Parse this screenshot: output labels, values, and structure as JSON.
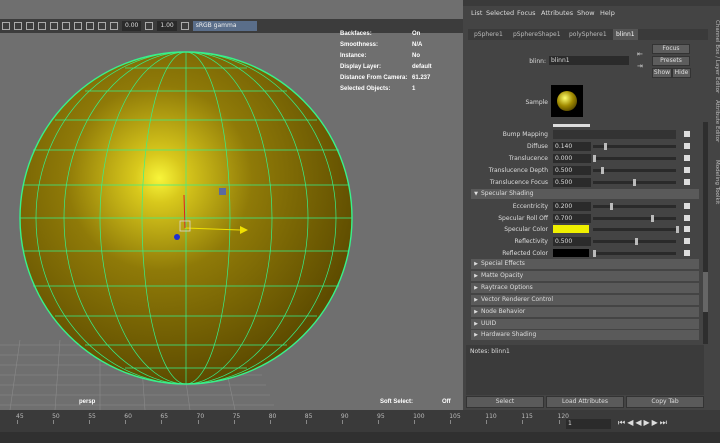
{
  "viewport": {
    "toolbar": {
      "value1": "0.00",
      "value2": "1.00",
      "color_space": "sRGB gamma"
    },
    "hud": [
      {
        "label": "Backfaces:",
        "value": "On"
      },
      {
        "label": "Smoothness:",
        "value": "N/A"
      },
      {
        "label": "Instance:",
        "value": "No"
      },
      {
        "label": "Display Layer:",
        "value": "default"
      },
      {
        "label": "Distance From Camera:",
        "value": "61.237"
      },
      {
        "label": "Selected Objects:",
        "value": "1"
      }
    ],
    "camera": "persp",
    "soft_select": {
      "label": "Soft Select:",
      "value": "Off"
    }
  },
  "menu": [
    "List",
    "Selected",
    "Focus",
    "Attributes",
    "Show",
    "Help"
  ],
  "tabs": [
    "pSphere1",
    "pSphereShape1",
    "polySphere1",
    "blinn1"
  ],
  "active_tab": "blinn1",
  "node": {
    "label": "blinn:",
    "name": "blinn1"
  },
  "side_buttons": {
    "focus": "Focus",
    "presets": "Presets",
    "show": "Show",
    "hide": "Hide"
  },
  "sample_label": "Sample",
  "attributes": [
    {
      "label": "Bump Mapping",
      "value": "",
      "slider": null
    },
    {
      "label": "Diffuse",
      "value": "0.140",
      "slider": 0.14
    },
    {
      "label": "Translucence",
      "value": "0.000",
      "slider": 0.0
    },
    {
      "label": "Translucence Depth",
      "value": "0.500",
      "slider": 0.1
    },
    {
      "label": "Translucence Focus",
      "value": "0.500",
      "slider": 0.5
    }
  ],
  "specular_section": "Specular Shading",
  "specular": [
    {
      "label": "Eccentricity",
      "value": "0.200",
      "slider": 0.2
    },
    {
      "label": "Specular Roll Off",
      "value": "0.700",
      "slider": 0.7
    },
    {
      "label": "Specular Color",
      "color": "#f0f000"
    },
    {
      "label": "Reflectivity",
      "value": "0.500",
      "slider": 0.5
    },
    {
      "label": "Reflected Color",
      "color": "#000000"
    }
  ],
  "sections": [
    "Special Effects",
    "Matte Opacity",
    "Raytrace Options",
    "Vector Renderer Control",
    "Node Behavior",
    "UUID",
    "Hardware Shading"
  ],
  "notes": "Notes: blinn1",
  "bottom_buttons": [
    "Select",
    "Load Attributes",
    "Copy Tab"
  ],
  "side_tabs": [
    "Channel Box / Layer Editor",
    "Attribute Editor",
    "Modeling Toolkit"
  ],
  "timeline": {
    "ticks": [
      "45",
      "50",
      "55",
      "60",
      "65",
      "70",
      "75",
      "80",
      "85",
      "90",
      "95",
      "100",
      "105",
      "110",
      "115",
      "120"
    ],
    "current_frame": "1"
  }
}
